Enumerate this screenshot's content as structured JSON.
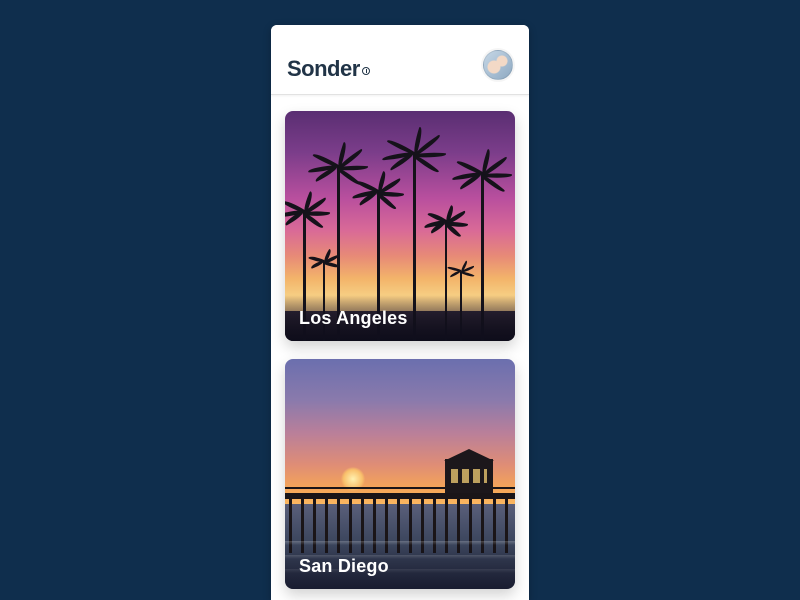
{
  "header": {
    "brand": "Sonder"
  },
  "cards": [
    {
      "label": "Los Angeles"
    },
    {
      "label": "San Diego"
    }
  ]
}
